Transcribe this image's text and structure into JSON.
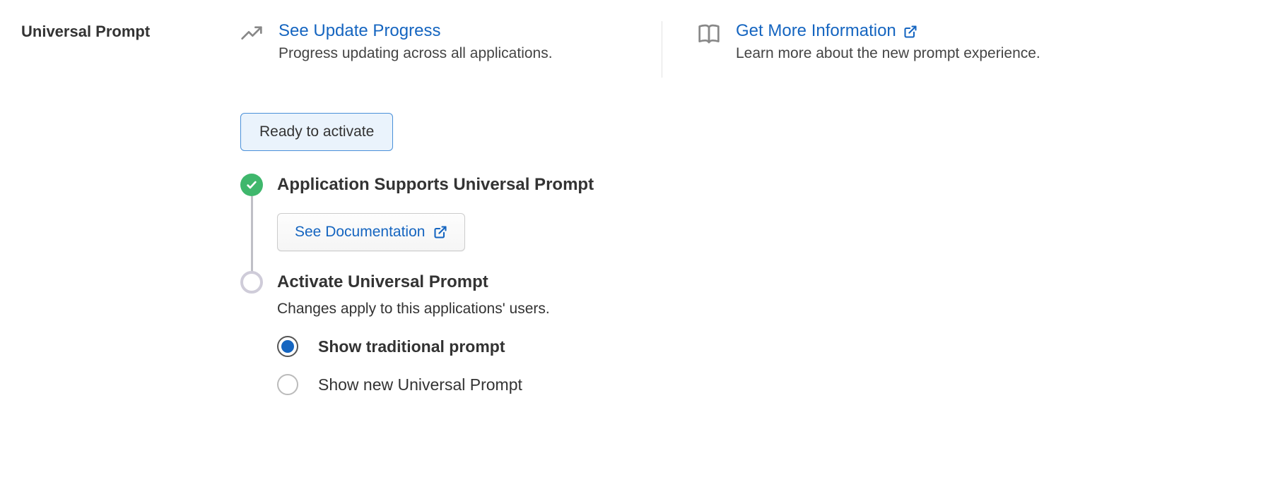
{
  "section": {
    "title": "Universal Prompt"
  },
  "infoLinks": {
    "progress": {
      "label": "See Update Progress",
      "desc": "Progress updating across all applications."
    },
    "moreInfo": {
      "label": "Get More Information",
      "desc": "Learn more about the new prompt experience."
    }
  },
  "badge": {
    "label": "Ready to activate"
  },
  "steps": {
    "supports": {
      "title": "Application Supports Universal Prompt",
      "docButton": "See Documentation"
    },
    "activate": {
      "title": "Activate Universal Prompt",
      "desc": "Changes apply to this applications' users.",
      "options": {
        "traditional": "Show traditional prompt",
        "newPrompt": "Show new Universal Prompt"
      }
    }
  }
}
